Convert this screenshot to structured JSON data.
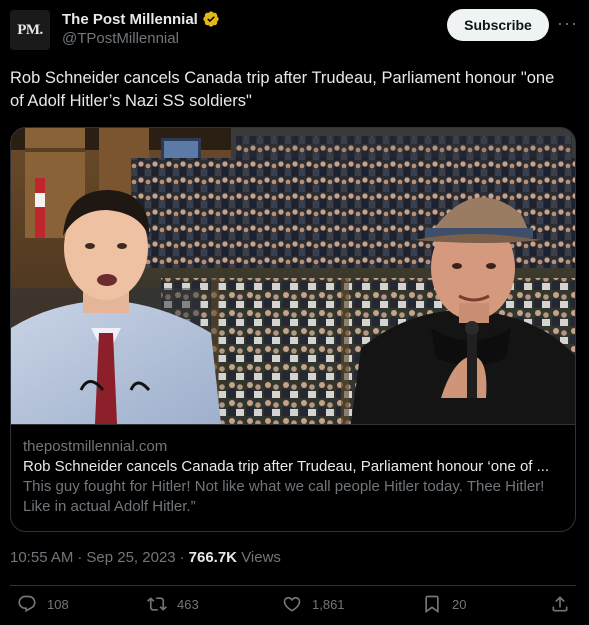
{
  "author": {
    "avatar_text": "PM.",
    "name": "The Post Millennial",
    "handle": "@TPostMillennial"
  },
  "buttons": {
    "subscribe": "Subscribe",
    "more": "···"
  },
  "tweet": {
    "text": "Rob Schneider cancels Canada trip after Trudeau, Parliament honour \"one of Adolf Hitler’s Nazi SS soldiers\""
  },
  "card": {
    "domain": "thepostmillennial.com",
    "title": "Rob Schneider cancels Canada trip after Trudeau, Parliament honour ‘one of ...",
    "description": "This guy fought for Hitler! Not like what we call people Hitler today. Thee Hitler! Like in actual Adolf Hitler.”"
  },
  "meta": {
    "time": "10:55 AM",
    "separator": "·",
    "date": "Sep 25, 2023",
    "separator2": "·",
    "views_count": "766.7K",
    "views_label": "Views"
  },
  "actions": {
    "replies": "108",
    "reposts": "463",
    "likes": "1,861",
    "bookmarks": "20"
  },
  "colors": {
    "background": "#000000",
    "text": "#e7e9ea",
    "secondary": "#71767b",
    "border": "#2f3336",
    "verified_gold": "#e2b719"
  }
}
